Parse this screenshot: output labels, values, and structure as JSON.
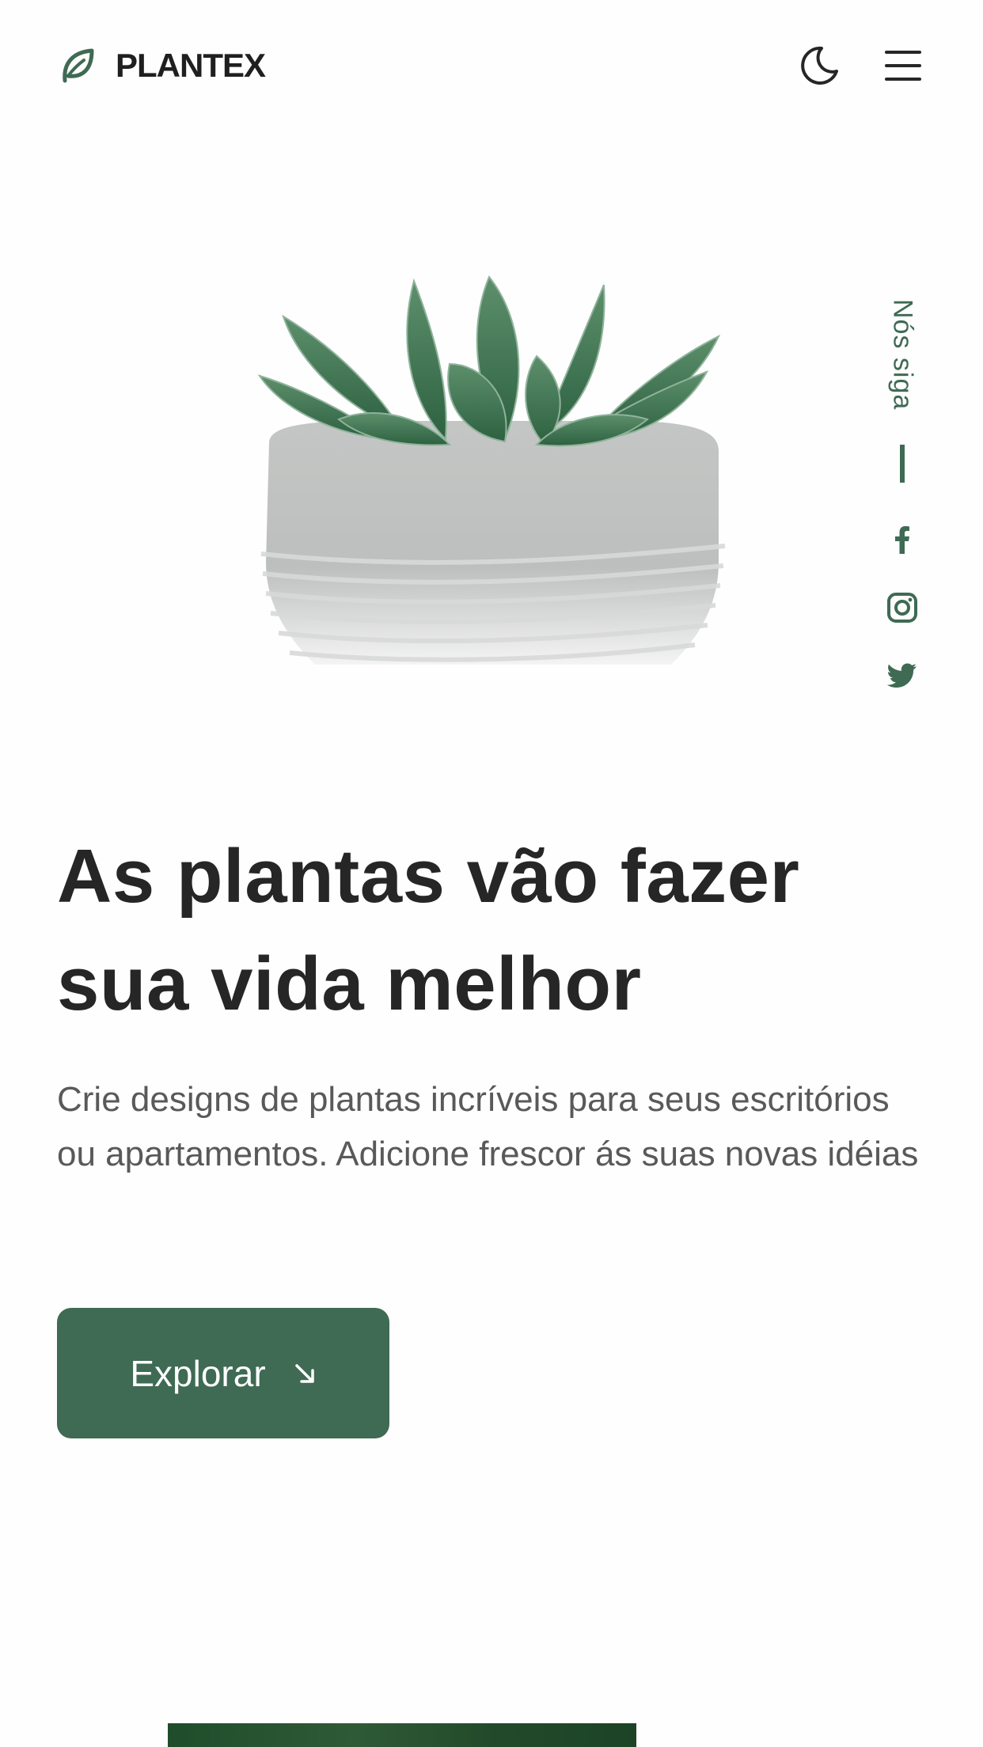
{
  "header": {
    "brand": "PLANTEX",
    "icons": {
      "logo": "leaf-icon",
      "theme": "moon-icon",
      "menu": "hamburger-menu-icon"
    }
  },
  "hero": {
    "title": "As plantas vão fazer sua vida melhor",
    "description": "Crie designs de plantas incríveis para seus escritórios ou apartamentos. Adicione frescor ás suas novas idéias",
    "button_label": "Explorar",
    "button_icon": "arrow-down-right-icon",
    "image": "succulent-in-concrete-pot"
  },
  "social": {
    "label": "Nós siga",
    "icons": [
      "facebook-icon",
      "instagram-icon",
      "twitter-icon"
    ]
  },
  "colors": {
    "primary": "#3f6a53",
    "text_dark": "#262626",
    "text_muted": "#595959",
    "background": "#fefefe"
  }
}
